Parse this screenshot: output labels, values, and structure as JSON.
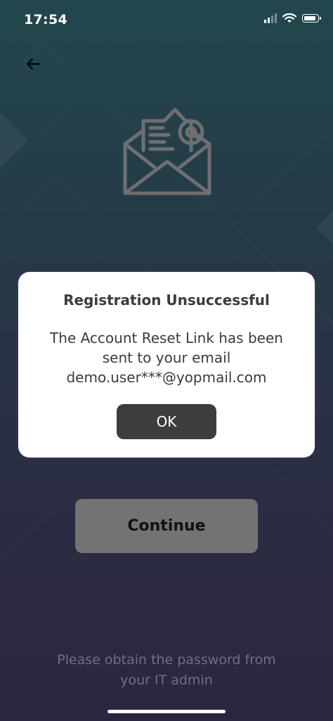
{
  "status_bar": {
    "time": "17:54",
    "icons": [
      "cellular-signal-icon",
      "wifi-icon",
      "battery-icon"
    ]
  },
  "nav": {
    "back_icon": "arrow-left-icon"
  },
  "illustration": {
    "icon": "envelope-email-icon"
  },
  "dialog": {
    "title": "Registration Unsuccessful",
    "message_lines": [
      "The Account Reset Link has been",
      "sent to your email",
      "demo.user***@yopmail.com"
    ],
    "ok_label": "OK"
  },
  "main": {
    "continue_label": "Continue"
  },
  "footer": {
    "note_lines": [
      "Please obtain the password from",
      "your IT admin"
    ]
  },
  "colors": {
    "background_top": "#23474d",
    "background_bottom": "#2c2540",
    "dialog_background": "#ffffff",
    "ok_button": "#3d3d3d",
    "continue_button": "#737373",
    "footer_text": "#6f6f82"
  }
}
